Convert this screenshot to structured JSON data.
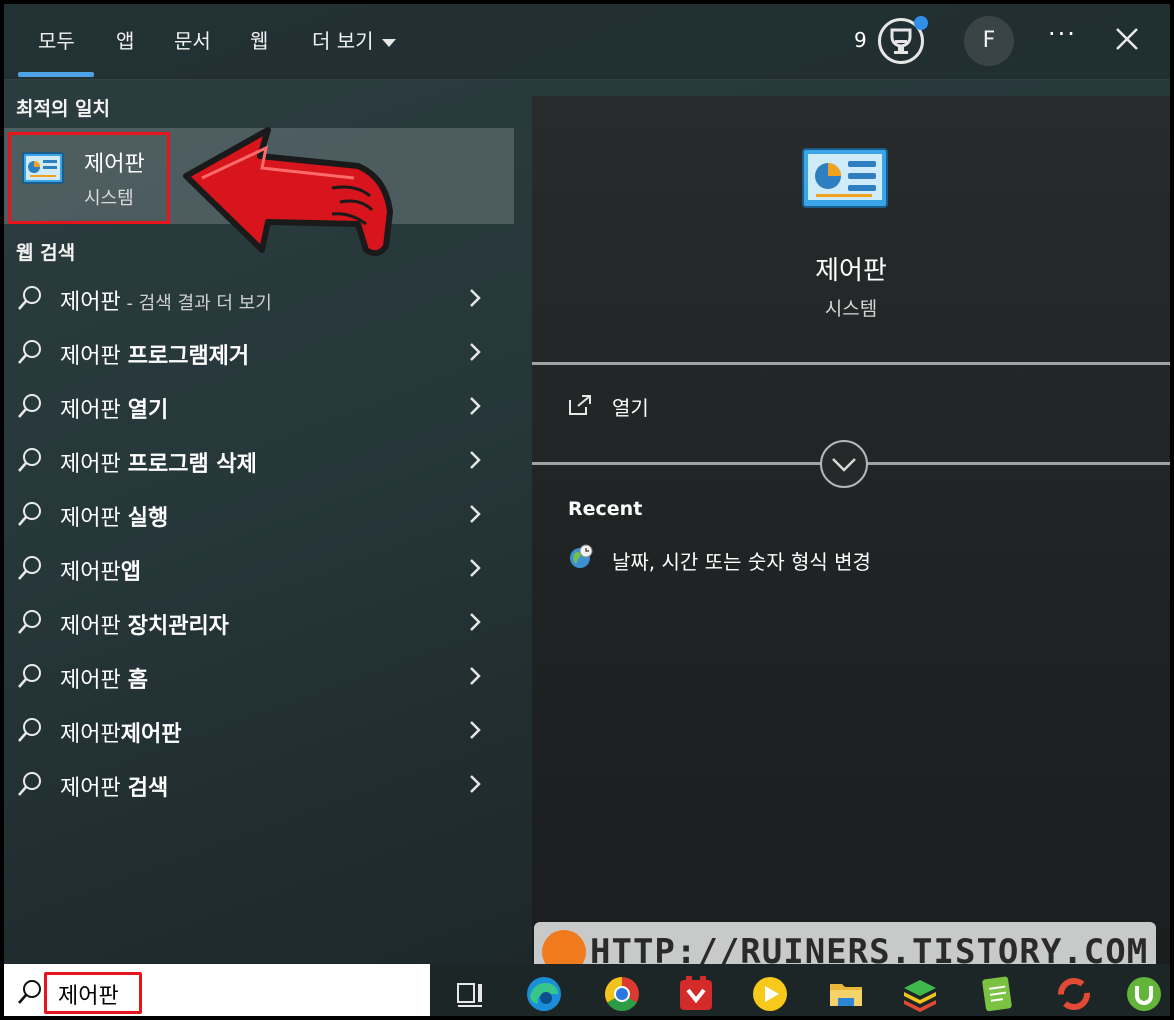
{
  "tabs": [
    {
      "label": "모두",
      "active": true
    },
    {
      "label": "앱"
    },
    {
      "label": "문서"
    },
    {
      "label": "웹"
    },
    {
      "label": "더 보기"
    }
  ],
  "header": {
    "points": "9",
    "avatar_letter": "F",
    "more_glyph": "···"
  },
  "best_match": {
    "heading": "최적의 일치",
    "title": "제어판",
    "subtitle": "시스템"
  },
  "web_search": {
    "heading": "웹 검색",
    "items": [
      {
        "query": "제어판",
        "rest": "",
        "hint": " - 검색 결과 더 보기"
      },
      {
        "query": "제어판 ",
        "rest": "프로그램제거",
        "hint": ""
      },
      {
        "query": "제어판 ",
        "rest": "열기",
        "hint": ""
      },
      {
        "query": "제어판 ",
        "rest": "프로그램 삭제",
        "hint": ""
      },
      {
        "query": "제어판 ",
        "rest": "실행",
        "hint": ""
      },
      {
        "query": "제어판",
        "rest": "앱",
        "hint": ""
      },
      {
        "query": "제어판 ",
        "rest": "장치관리자",
        "hint": ""
      },
      {
        "query": "제어판 ",
        "rest": "홈",
        "hint": ""
      },
      {
        "query": "제어판",
        "rest": "제어판",
        "hint": ""
      },
      {
        "query": "제어판 ",
        "rest": "검색",
        "hint": ""
      }
    ]
  },
  "preview": {
    "title": "제어판",
    "subtitle": "시스템",
    "open_label": "열기",
    "recent_heading": "Recent",
    "recent_item": "날짜, 시간 또는 숫자 형식 변경"
  },
  "watermark": {
    "text": "HTTP://RUINERS.TISTORY.COM"
  },
  "taskbar": {
    "search_value": "제어판",
    "icons": [
      "task-view-icon",
      "edge-icon",
      "chrome-icon",
      "app-red-icon",
      "media-player-icon",
      "file-explorer-icon",
      "bluestacks-icon",
      "notepad-green-icon",
      "app-ring-icon",
      "utorrent-icon"
    ]
  },
  "colors": {
    "accent": "#4ea2e6",
    "highlight_red": "#e8141c",
    "notification_blue": "#2f8fe8"
  }
}
